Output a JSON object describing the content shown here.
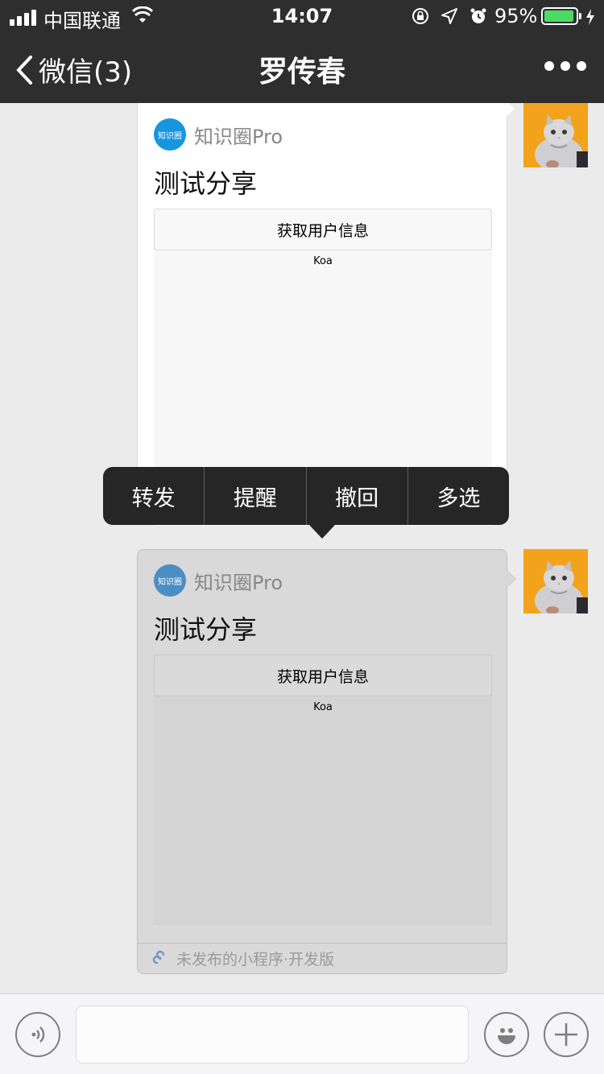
{
  "status": {
    "carrier": "中国联通",
    "time": "14:07",
    "battery": "95%",
    "battery_level": 0.95
  },
  "nav": {
    "back_label": "微信(3)",
    "title": "罗传春",
    "more_icon": "more-dots-icon"
  },
  "messages": [
    {
      "app_name": "知识圈Pro",
      "app_logo_text": "知识圈",
      "title": "测试分享",
      "button_label": "获取用户信息",
      "body_text": "Koa"
    },
    {
      "app_name": "知识圈Pro",
      "app_logo_text": "知识圈",
      "title": "测试分享",
      "button_label": "获取用户信息",
      "body_text": "Koa",
      "footer": "未发布的小程序·开发版"
    }
  ],
  "context_menu": {
    "items": [
      "转发",
      "提醒",
      "撤回",
      "多选"
    ]
  },
  "input_bar": {
    "voice_icon": "voice-icon",
    "emoji_icon": "emoji-icon",
    "plus_icon": "plus-icon"
  },
  "colors": {
    "bar_bg": "#2e2e2f",
    "chat_bg": "#ebebeb",
    "menu_bg": "#262626",
    "battery_green": "#4cd964",
    "app_logo": "#1796e0"
  }
}
